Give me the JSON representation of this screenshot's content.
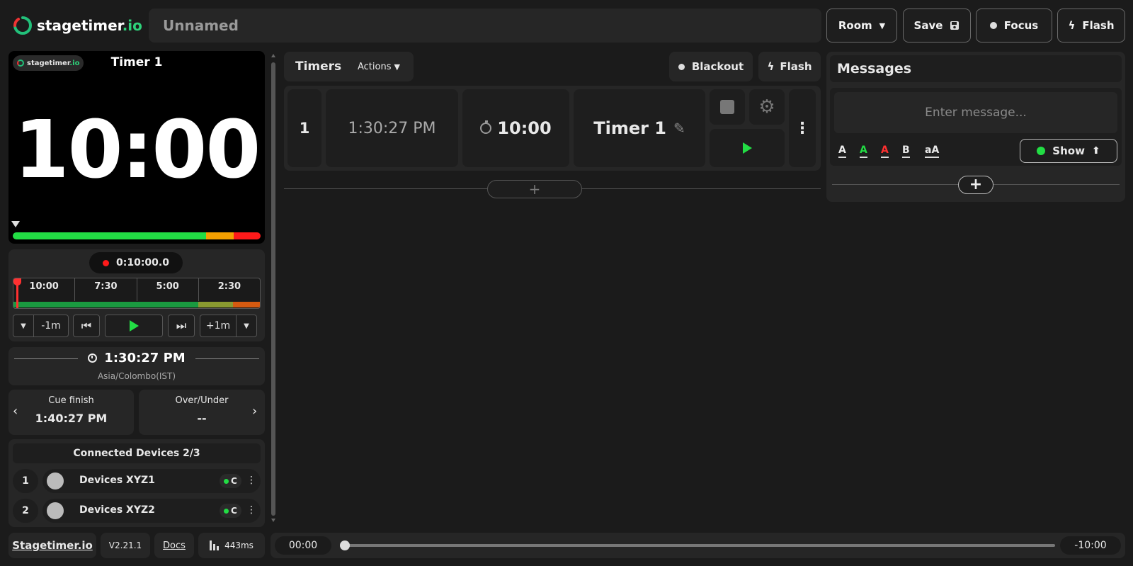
{
  "header": {
    "logo_text": "stagetimer",
    "logo_suffix": ".io",
    "room_name": "Unnamed",
    "room_button": "Room",
    "save_button": "Save",
    "focus_button": "Focus",
    "flash_button": "Flash"
  },
  "preview": {
    "badge_text": "stagetimer",
    "badge_suffix": ".io",
    "title": "Timer 1",
    "time": "10:00"
  },
  "transport": {
    "elapsed": "0:10:00.0",
    "markers": [
      "10:00",
      "7:30",
      "5:00",
      "2:30"
    ],
    "minus_label": "-1m",
    "plus_label": "+1m"
  },
  "clock": {
    "time": "1:30:27 PM",
    "timezone": "Asia/Colombo(IST)"
  },
  "cue": {
    "finish_label": "Cue finish",
    "finish_value": "1:40:27 PM",
    "over_label": "Over/Under",
    "over_value": "--"
  },
  "devices": {
    "title": "Connected Devices 2/3",
    "items": [
      {
        "index": "1",
        "name": "Devices XYZ1",
        "status": "C"
      },
      {
        "index": "2",
        "name": "Devices XYZ2",
        "status": "C"
      }
    ]
  },
  "footer": {
    "link": "Stagetimer.io",
    "version": "V2.21.1",
    "docs": "Docs",
    "latency": "443ms",
    "start_time": "00:00",
    "end_time": "-10:00"
  },
  "timers": {
    "title": "Timers",
    "actions": "Actions",
    "blackout": "Blackout",
    "flash": "Flash",
    "rows": [
      {
        "index": "1",
        "start": "1:30:27 PM",
        "duration": "10:00",
        "name": "Timer 1"
      }
    ]
  },
  "messages": {
    "title": "Messages",
    "placeholder": "Enter message...",
    "formats": [
      "A",
      "A",
      "A",
      "B",
      "aA"
    ],
    "show_button": "Show"
  },
  "colors": {
    "green": "#22dd44",
    "yellow": "#f5a000",
    "red": "#ff1a1a",
    "background": "#1b1b1b"
  }
}
